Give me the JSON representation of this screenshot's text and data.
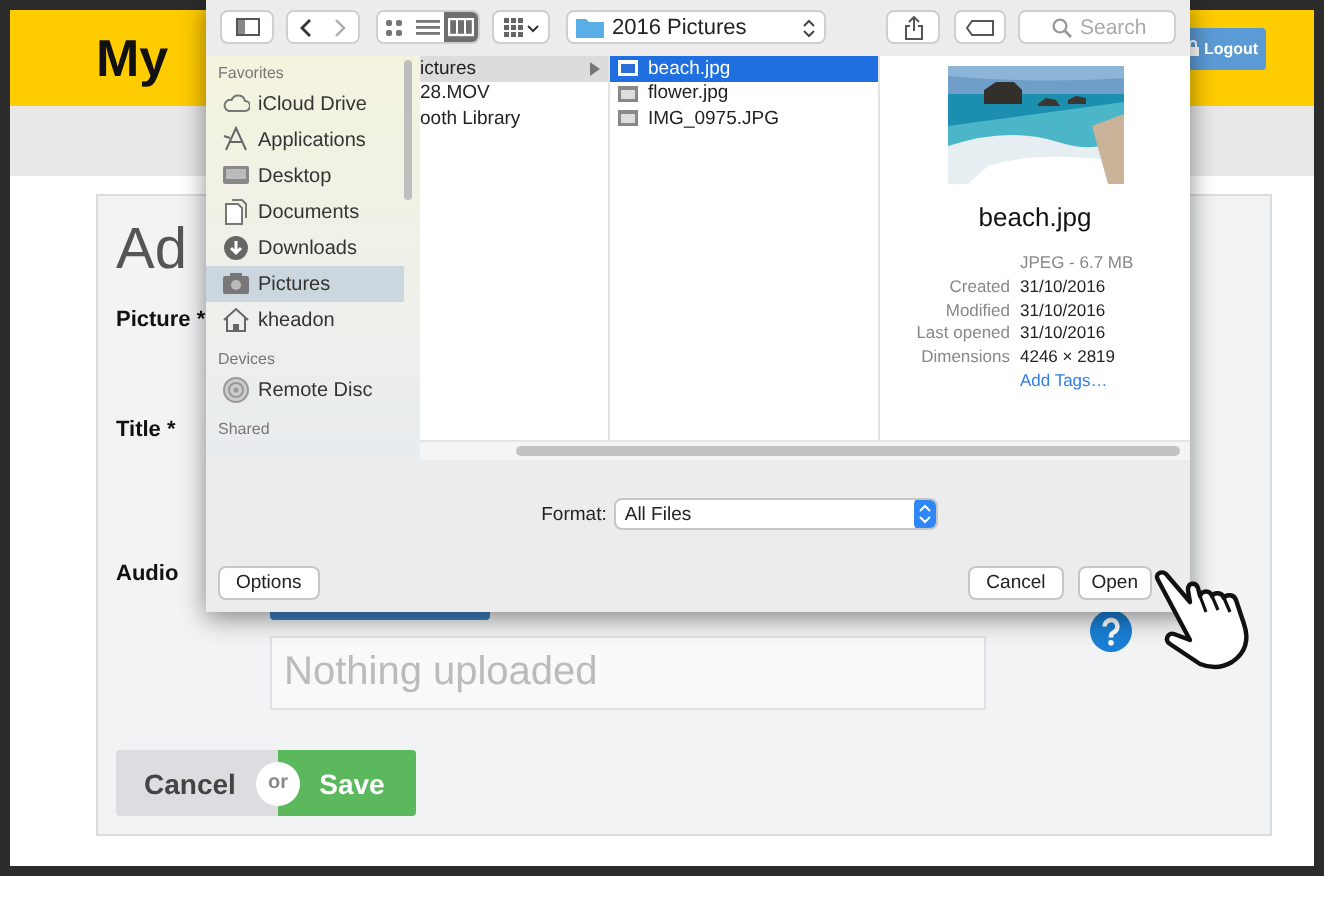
{
  "site": {
    "title": "My",
    "logout": "Logout"
  },
  "form": {
    "heading": "Ad",
    "labels": [
      "Picture *",
      "Title *",
      "Audio"
    ],
    "audio_placeholder": "Nothing uploaded",
    "cancel": "Cancel",
    "or": "or",
    "save": "Save"
  },
  "dialog": {
    "view_modes": [
      {
        "selected": false
      },
      {
        "selected": false
      },
      {
        "selected": true
      }
    ],
    "location": "2016 Pictures",
    "search_placeholder": "Search",
    "sidebar": [
      {
        "heading": "Favorites",
        "items": [
          {
            "label": "iCloud Drive",
            "selected": false
          },
          {
            "label": "Applications",
            "selected": false
          },
          {
            "label": "Desktop",
            "selected": false
          },
          {
            "label": "Documents",
            "selected": false
          },
          {
            "label": "Downloads",
            "selected": false
          },
          {
            "label": "Pictures",
            "selected": true
          },
          {
            "label": "kheadon",
            "selected": false
          }
        ]
      },
      {
        "heading": "Devices",
        "items": [
          {
            "label": "Remote Disc",
            "selected": false
          }
        ]
      },
      {
        "heading": "Shared"
      }
    ],
    "column_1": [
      {
        "label": "ictures",
        "selected": true,
        "folder": true
      },
      {
        "label": "28.MOV",
        "selected": false,
        "folder": false
      },
      {
        "label": "ooth Library",
        "selected": false,
        "folder": false
      }
    ],
    "column_2": [
      {
        "label": "beach.jpg",
        "selected": true
      },
      {
        "label": "flower.jpg",
        "selected": false
      },
      {
        "label": "IMG_0975.JPG",
        "selected": false
      }
    ],
    "preview": {
      "name": "beach.jpg",
      "summary": "JPEG - 6.7 MB",
      "info": [
        {
          "label": "Created",
          "value": "31/10/2016"
        },
        {
          "label": "Modified",
          "value": "31/10/2016"
        },
        {
          "label": "Last opened",
          "value": "31/10/2016"
        },
        {
          "label": "Dimensions",
          "value": "4246 × 2819"
        }
      ],
      "add_tags": "Add Tags…"
    },
    "format": {
      "label": "Format:",
      "value": "All Files"
    },
    "buttons": {
      "options": "Options",
      "cancel": "Cancel",
      "open": "Open"
    }
  }
}
